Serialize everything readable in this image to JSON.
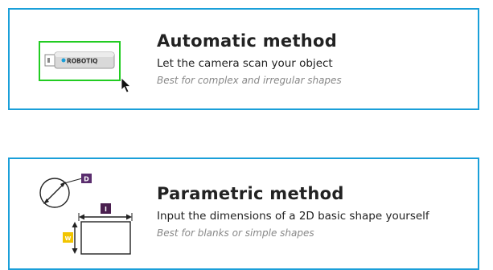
{
  "automatic": {
    "title": "Automatic method",
    "subtitle": "Let the camera scan your object",
    "hint": "Best for complex and irregular shapes",
    "device_label": "ROBOTIQ"
  },
  "parametric": {
    "title": "Parametric method",
    "subtitle": "Input the dimensions of a 2D basic shape yourself",
    "hint": "Best for blanks or simple shapes",
    "diameter_badge": "D",
    "length_badge": "l",
    "width_badge": "W"
  },
  "colors": {
    "border": "#1a9fd9",
    "selection": "#22cc22",
    "diameter_badge": "#5a2d6e",
    "length_badge": "#4a1f4f",
    "width_badge": "#f2c500"
  }
}
